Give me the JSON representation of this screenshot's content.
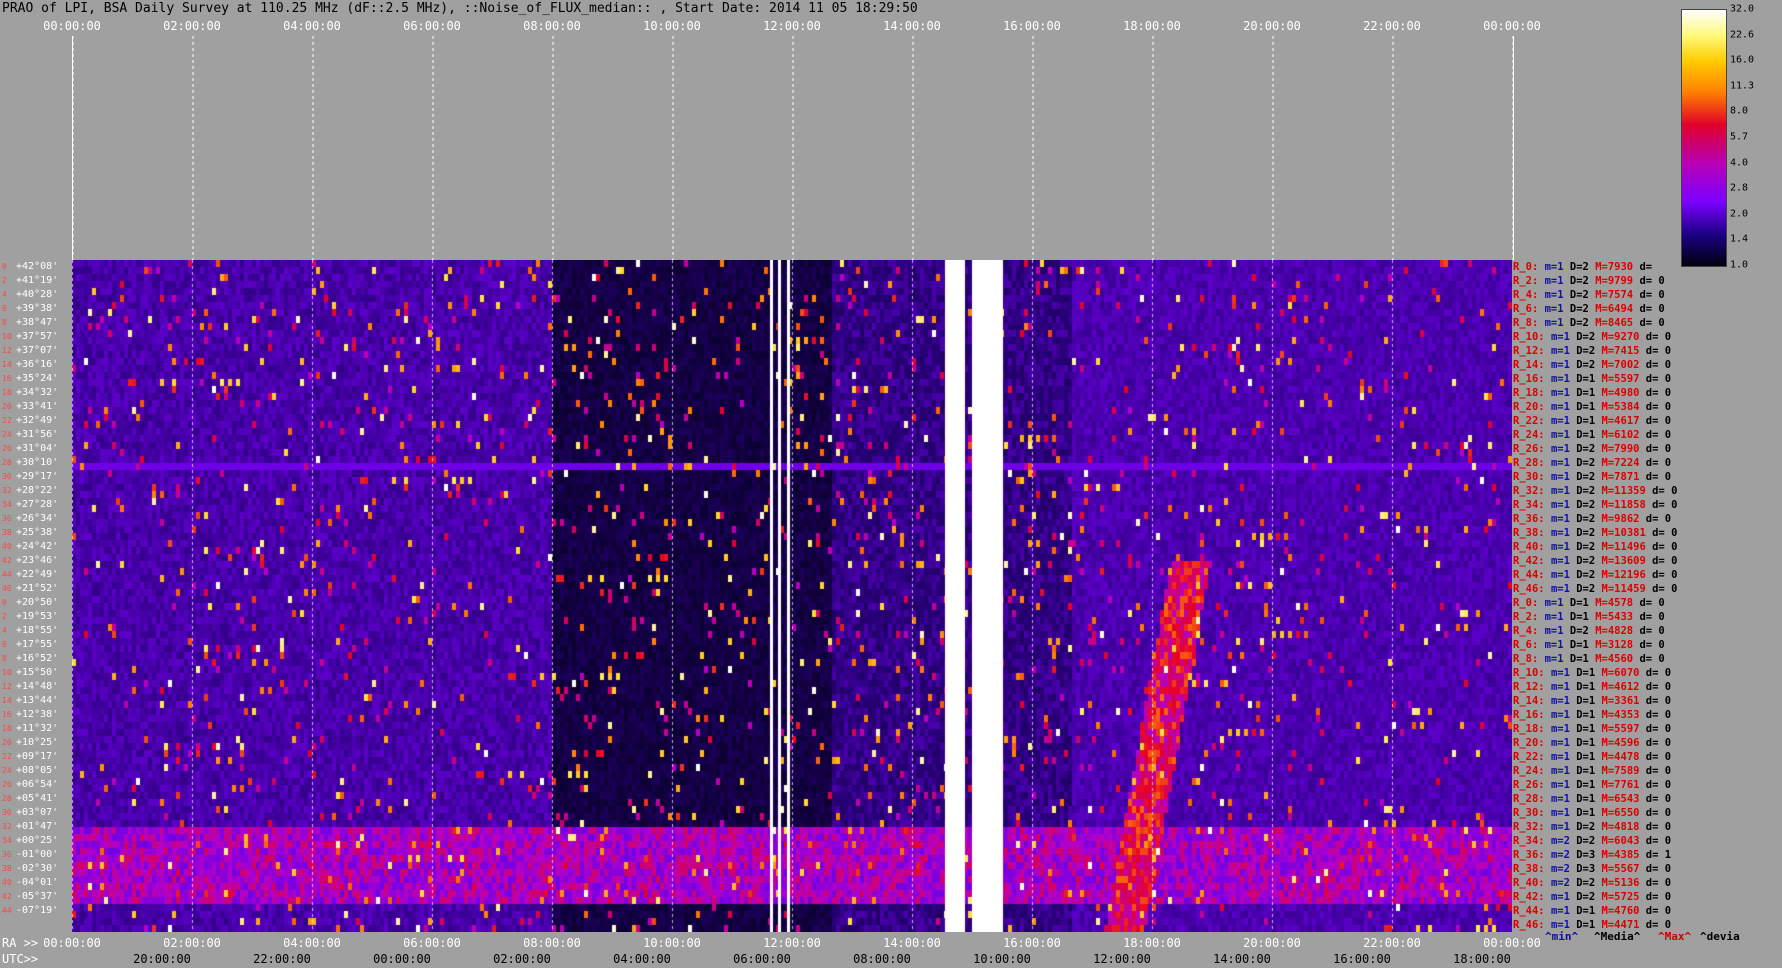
{
  "title": "PRAO of LPI, BSA Daily Survey at 110.25 MHz (dF::2.5 MHz), ::Noise_of_FLUX_median:: , Start Date: 2014 11 05 18:29:50",
  "top_axis_ticks": [
    "00:00:00",
    "02:00:00",
    "04:00:00",
    "06:00:00",
    "08:00:00",
    "10:00:00",
    "12:00:00",
    "14:00:00",
    "16:00:00",
    "18:00:00",
    "20:00:00",
    "22:00:00",
    "00:00:00"
  ],
  "declinations": [
    {
      "idx": "0",
      "value": "+42°08'"
    },
    {
      "idx": "2",
      "value": "+41°19'"
    },
    {
      "idx": "4",
      "value": "+40°28'"
    },
    {
      "idx": "6",
      "value": "+39°38'"
    },
    {
      "idx": "8",
      "value": "+38°47'"
    },
    {
      "idx": "10",
      "value": "+37°57'"
    },
    {
      "idx": "12",
      "value": "+37°07'"
    },
    {
      "idx": "14",
      "value": "+36°16'"
    },
    {
      "idx": "16",
      "value": "+35°24'"
    },
    {
      "idx": "18",
      "value": "+34°32'"
    },
    {
      "idx": "20",
      "value": "+33°41'"
    },
    {
      "idx": "22",
      "value": "+32°49'"
    },
    {
      "idx": "24",
      "value": "+31°56'"
    },
    {
      "idx": "26",
      "value": "+31°04'"
    },
    {
      "idx": "28",
      "value": "+30°10'"
    },
    {
      "idx": "30",
      "value": "+29°17'"
    },
    {
      "idx": "32",
      "value": "+28°22'"
    },
    {
      "idx": "34",
      "value": "+27°28'"
    },
    {
      "idx": "36",
      "value": "+26°34'"
    },
    {
      "idx": "38",
      "value": "+25°38'"
    },
    {
      "idx": "40",
      "value": "+24°42'"
    },
    {
      "idx": "42",
      "value": "+23°46'"
    },
    {
      "idx": "44",
      "value": "+22°49'"
    },
    {
      "idx": "46",
      "value": "+21°52'"
    },
    {
      "idx": "0",
      "value": "+20°50'"
    },
    {
      "idx": "2",
      "value": "+19°53'"
    },
    {
      "idx": "4",
      "value": "+18°55'"
    },
    {
      "idx": "6",
      "value": "+17°55'"
    },
    {
      "idx": "8",
      "value": "+16°52'"
    },
    {
      "idx": "10",
      "value": "+15°50'"
    },
    {
      "idx": "12",
      "value": "+14°48'"
    },
    {
      "idx": "14",
      "value": "+13°44'"
    },
    {
      "idx": "16",
      "value": "+12°38'"
    },
    {
      "idx": "18",
      "value": "+11°32'"
    },
    {
      "idx": "20",
      "value": "+10°25'"
    },
    {
      "idx": "22",
      "value": "+09°17'"
    },
    {
      "idx": "24",
      "value": "+08°05'"
    },
    {
      "idx": "26",
      "value": "+06°54'"
    },
    {
      "idx": "28",
      "value": "+05°41'"
    },
    {
      "idx": "30",
      "value": "+03°07'"
    },
    {
      "idx": "32",
      "value": "+01°47'"
    },
    {
      "idx": "34",
      "value": "+00°25'"
    },
    {
      "idx": "36",
      "value": "-01°00'"
    },
    {
      "idx": "38",
      "value": "-02°30'"
    },
    {
      "idx": "40",
      "value": "-04°01'"
    },
    {
      "idx": "42",
      "value": "-05°37'"
    },
    {
      "idx": "44",
      "value": "-07°19'"
    }
  ],
  "records": [
    {
      "r": "R_0:",
      "m": "m=1",
      "d": "D=2",
      "M": "M=7930",
      "dd": "d= "
    },
    {
      "r": "R_2:",
      "m": "m=1",
      "d": "D=2",
      "M": "M=9799",
      "dd": "d= 0"
    },
    {
      "r": "R_4:",
      "m": "m=1",
      "d": "D=2",
      "M": "M=7574",
      "dd": "d= 0"
    },
    {
      "r": "R_6:",
      "m": "m=1",
      "d": "D=2",
      "M": "M=6494",
      "dd": "d= 0"
    },
    {
      "r": "R_8:",
      "m": "m=1",
      "d": "D=2",
      "M": "M=8465",
      "dd": "d= 0"
    },
    {
      "r": "R_10:",
      "m": "m=1",
      "d": "D=2",
      "M": "M=9270",
      "dd": "d= 0"
    },
    {
      "r": "R_12:",
      "m": "m=1",
      "d": "D=2",
      "M": "M=7415",
      "dd": "d= 0"
    },
    {
      "r": "R_14:",
      "m": "m=1",
      "d": "D=2",
      "M": "M=7002",
      "dd": "d= 0"
    },
    {
      "r": "R_16:",
      "m": "m=1",
      "d": "D=1",
      "M": "M=5597",
      "dd": "d= 0"
    },
    {
      "r": "R_18:",
      "m": "m=1",
      "d": "D=1",
      "M": "M=4980",
      "dd": "d= 0"
    },
    {
      "r": "R_20:",
      "m": "m=1",
      "d": "D=1",
      "M": "M=5384",
      "dd": "d= 0"
    },
    {
      "r": "R_22:",
      "m": "m=1",
      "d": "D=1",
      "M": "M=4617",
      "dd": "d= 0"
    },
    {
      "r": "R_24:",
      "m": "m=1",
      "d": "D=1",
      "M": "M=6102",
      "dd": "d= 0"
    },
    {
      "r": "R_26:",
      "m": "m=1",
      "d": "D=2",
      "M": "M=7990",
      "dd": "d= 0"
    },
    {
      "r": "R_28:",
      "m": "m=1",
      "d": "D=2",
      "M": "M=7224",
      "dd": "d= 0"
    },
    {
      "r": "R_30:",
      "m": "m=1",
      "d": "D=2",
      "M": "M=7871",
      "dd": "d= 0"
    },
    {
      "r": "R_32:",
      "m": "m=1",
      "d": "D=2",
      "M": "M=11359",
      "dd": "d= 0"
    },
    {
      "r": "R_34:",
      "m": "m=1",
      "d": "D=2",
      "M": "M=11858",
      "dd": "d= 0"
    },
    {
      "r": "R_36:",
      "m": "m=1",
      "d": "D=2",
      "M": "M=9862",
      "dd": "d= 0"
    },
    {
      "r": "R_38:",
      "m": "m=1",
      "d": "D=2",
      "M": "M=10381",
      "dd": "d= 0"
    },
    {
      "r": "R_40:",
      "m": "m=1",
      "d": "D=2",
      "M": "M=11496",
      "dd": "d= 0"
    },
    {
      "r": "R_42:",
      "m": "m=1",
      "d": "D=2",
      "M": "M=13609",
      "dd": "d= 0"
    },
    {
      "r": "R_44:",
      "m": "m=1",
      "d": "D=2",
      "M": "M=12196",
      "dd": "d= 0"
    },
    {
      "r": "R_46:",
      "m": "m=1",
      "d": "D=2",
      "M": "M=11459",
      "dd": "d= 0"
    },
    {
      "r": "R_0:",
      "m": "m=1",
      "d": "D=1",
      "M": "M=4578",
      "dd": "d= 0"
    },
    {
      "r": "R_2:",
      "m": "m=1",
      "d": "D=1",
      "M": "M=5433",
      "dd": "d= 0"
    },
    {
      "r": "R_4:",
      "m": "m=1",
      "d": "D=2",
      "M": "M=4828",
      "dd": "d= 0"
    },
    {
      "r": "R_6:",
      "m": "m=1",
      "d": "D=1",
      "M": "M=3128",
      "dd": "d= 0"
    },
    {
      "r": "R_8:",
      "m": "m=1",
      "d": "D=1",
      "M": "M=4560",
      "dd": "d= 0"
    },
    {
      "r": "R_10:",
      "m": "m=1",
      "d": "D=1",
      "M": "M=6070",
      "dd": "d= 0"
    },
    {
      "r": "R_12:",
      "m": "m=1",
      "d": "D=1",
      "M": "M=4612",
      "dd": "d= 0"
    },
    {
      "r": "R_14:",
      "m": "m=1",
      "d": "D=1",
      "M": "M=3361",
      "dd": "d= 0"
    },
    {
      "r": "R_16:",
      "m": "m=1",
      "d": "D=1",
      "M": "M=4353",
      "dd": "d= 0"
    },
    {
      "r": "R_18:",
      "m": "m=1",
      "d": "D=1",
      "M": "M=5597",
      "dd": "d= 0"
    },
    {
      "r": "R_20:",
      "m": "m=1",
      "d": "D=1",
      "M": "M=4596",
      "dd": "d= 0"
    },
    {
      "r": "R_22:",
      "m": "m=1",
      "d": "D=1",
      "M": "M=4478",
      "dd": "d= 0"
    },
    {
      "r": "R_24:",
      "m": "m=1",
      "d": "D=1",
      "M": "M=7589",
      "dd": "d= 0"
    },
    {
      "r": "R_26:",
      "m": "m=1",
      "d": "D=1",
      "M": "M=7761",
      "dd": "d= 0"
    },
    {
      "r": "R_28:",
      "m": "m=1",
      "d": "D=1",
      "M": "M=6543",
      "dd": "d= 0"
    },
    {
      "r": "R_30:",
      "m": "m=1",
      "d": "D=1",
      "M": "M=6550",
      "dd": "d= 0"
    },
    {
      "r": "R_32:",
      "m": "m=1",
      "d": "D=2",
      "M": "M=4818",
      "dd": "d= 0"
    },
    {
      "r": "R_34:",
      "m": "m=2",
      "d": "D=2",
      "M": "M=6043",
      "dd": "d= 0"
    },
    {
      "r": "R_36:",
      "m": "m=2",
      "d": "D=3",
      "M": "M=4385",
      "dd": "d= 1"
    },
    {
      "r": "R_38:",
      "m": "m=2",
      "d": "D=3",
      "M": "M=5567",
      "dd": "d= 0"
    },
    {
      "r": "R_40:",
      "m": "m=2",
      "d": "D=2",
      "M": "M=5136",
      "dd": "d= 0"
    },
    {
      "r": "R_42:",
      "m": "m=1",
      "d": "D=2",
      "M": "M=5725",
      "dd": "d= 0"
    },
    {
      "r": "R_44:",
      "m": "m=1",
      "d": "D=1",
      "M": "M=4760",
      "dd": "d= 0"
    },
    {
      "r": "R_46:",
      "m": "m=1",
      "d": "D=1",
      "M": "M=4471",
      "dd": "d= 0"
    }
  ],
  "colorbar_labels": [
    "32.0",
    "22.6",
    "16.0",
    "11.3",
    "8.0",
    "5.7",
    "4.0",
    "2.8",
    "2.0",
    "1.4",
    "1.0"
  ],
  "ra_label": "RA >>",
  "ra_ticks": [
    "00:00:00",
    "02:00:00",
    "04:00:00",
    "06:00:00",
    "08:00:00",
    "10:00:00",
    "12:00:00",
    "14:00:00",
    "16:00:00",
    "18:00:00",
    "20:00:00",
    "22:00:00",
    "00:00:00"
  ],
  "utc_label": "UTC>>",
  "utc_ticks": [
    "20:00:00",
    "22:00:00",
    "00:00:00",
    "02:00:00",
    "04:00:00",
    "06:00:00",
    "08:00:00",
    "10:00:00",
    "12:00:00",
    "14:00:00",
    "16:00:00",
    "18:00:00"
  ],
  "legend": {
    "min": "^min^",
    "media": "^Media^",
    "max": "^Max^",
    "devia": "^devia"
  },
  "colors": {
    "bg": "#a0a0a0",
    "min": "#1010a0",
    "max": "#d00000",
    "rlabel": "#d00000"
  }
}
